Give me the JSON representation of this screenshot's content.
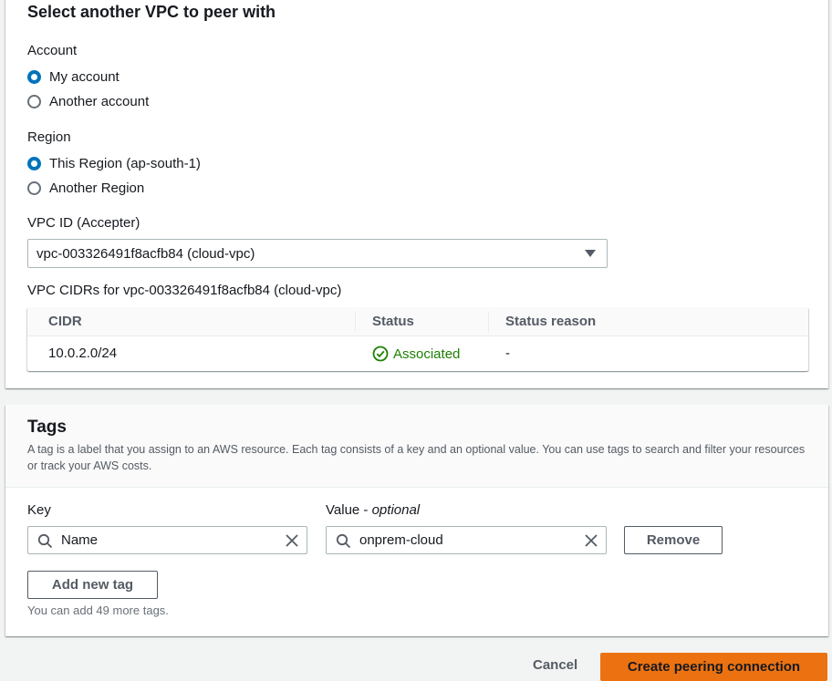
{
  "peer_section": {
    "title": "Select another VPC to peer with",
    "account": {
      "label": "Account",
      "options": [
        "My account",
        "Another account"
      ],
      "selected": "My account"
    },
    "region": {
      "label": "Region",
      "options": [
        "This Region (ap-south-1)",
        "Another Region"
      ],
      "selected": "This Region (ap-south-1)"
    },
    "vpc_id": {
      "label": "VPC ID (Accepter)",
      "value": "vpc-003326491f8acfb84 (cloud-vpc)"
    },
    "cidrs": {
      "label": "VPC CIDRs for vpc-003326491f8acfb84 (cloud-vpc)",
      "columns": [
        "CIDR",
        "Status",
        "Status reason"
      ],
      "rows": [
        {
          "cidr": "10.0.2.0/24",
          "status": "Associated",
          "reason": "-"
        }
      ]
    }
  },
  "tags_section": {
    "title": "Tags",
    "description": "A tag is a label that you assign to an AWS resource. Each tag consists of a key and an optional value. You can use tags to search and filter your resources or track your AWS costs.",
    "key_label": "Key",
    "value_label": "Value - ",
    "value_optional": "optional",
    "tags": [
      {
        "key": "Name",
        "value": "onprem-cloud"
      }
    ],
    "remove_label": "Remove",
    "add_label": "Add new tag",
    "hint": "You can add 49 more tags."
  },
  "footer": {
    "cancel_label": "Cancel",
    "submit_label": "Create peering connection"
  },
  "colors": {
    "primary": "#ec7211",
    "selected_radio": "#0073bb",
    "success": "#1d8102"
  },
  "icons": [
    "caret-down-icon",
    "status-success-icon",
    "search-icon",
    "clear-icon"
  ]
}
